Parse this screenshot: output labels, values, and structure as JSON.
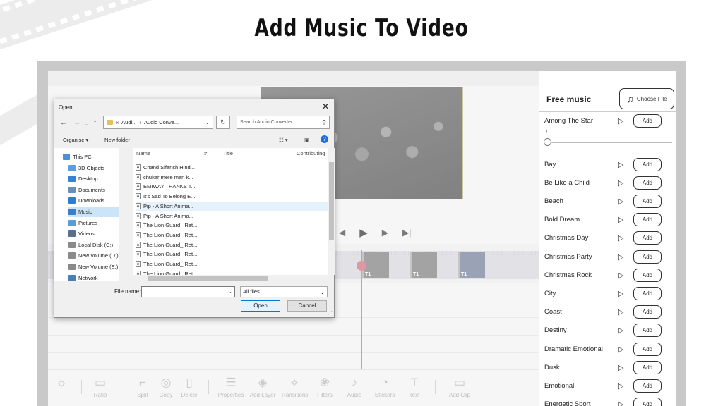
{
  "heading": "Add Music To Video",
  "dialog": {
    "title": "Open",
    "address": [
      "«",
      "Audi...",
      "›",
      "Audio Conve..."
    ],
    "search_placeholder": "Search Audio Converter",
    "organise": "Organise ▾",
    "new_folder": "New folder",
    "nav_items": [
      {
        "label": "This PC",
        "color": "#4a90d9"
      },
      {
        "label": "3D Objects",
        "color": "#5aa0e0"
      },
      {
        "label": "Desktop",
        "color": "#3b7fd0"
      },
      {
        "label": "Documents",
        "color": "#6b8fb5"
      },
      {
        "label": "Downloads",
        "color": "#2f7bd6"
      },
      {
        "label": "Music",
        "color": "#3d7cc9"
      },
      {
        "label": "Pictures",
        "color": "#5c9bd6"
      },
      {
        "label": "Videos",
        "color": "#5a6f8a"
      },
      {
        "label": "Local Disk (C:)",
        "color": "#8a8a8a"
      },
      {
        "label": "New Volume (D:)",
        "color": "#8a8a8a"
      },
      {
        "label": "New Volume (E:)",
        "color": "#8a8a8a"
      },
      {
        "label": "Network",
        "color": "#4a7fb5"
      }
    ],
    "columns": {
      "name": "Name",
      "num": "#",
      "title": "Title",
      "contrib": "Contributing"
    },
    "files": [
      "Chand Sifarish Hind...",
      "chukar mere man k...",
      "EMIWAY  THANKS T...",
      "It's Sad To Belong  E...",
      "Pip - A Short Anima...",
      "Pip - A Short Anima...",
      "The Lion Guard_ Ret...",
      "The Lion Guard_ Ret...",
      "The Lion Guard_ Ret...",
      "The Lion Guard_ Ret...",
      "The Lion Guard_ Ret...",
      "The Lion Guard_ Ret..."
    ],
    "file_name_label": "File name:",
    "file_name_value": "",
    "filter": "All files",
    "open": "Open",
    "cancel": "Cancel"
  },
  "timeline": {
    "clip_label": "T1"
  },
  "toolbar": [
    "Ratio",
    "Split",
    "Copy",
    "Delete",
    "Properties",
    "Add Layer",
    "Transitions",
    "Filters",
    "Audio",
    "Stickers",
    "Text",
    "Add Clip"
  ],
  "music": {
    "title": "Free music",
    "choose_file": "Choose File",
    "time": "/",
    "add_label": "Add",
    "tracks": [
      "Among The Star",
      "Bay",
      "Be Like a Child",
      "Beach",
      "Bold Dream",
      "Christmas Day",
      "Christmas Party",
      "Christmas Rock",
      "City",
      "Coast",
      "Destiny",
      "Dramatic Emotional",
      "Dusk",
      "Emotional",
      "Energetic Sport"
    ]
  }
}
